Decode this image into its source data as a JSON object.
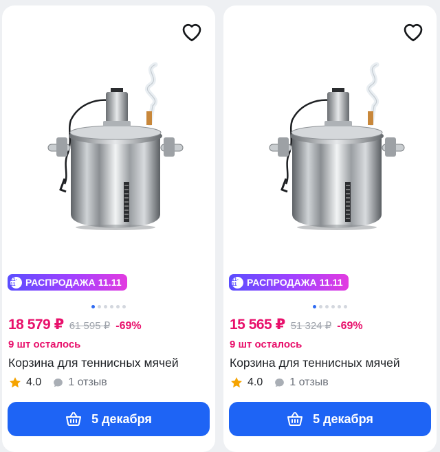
{
  "colors": {
    "accent_pink": "#e8106b",
    "button_blue": "#1e64f5",
    "promo_gradient": [
      "#5a4dff",
      "#a341ff",
      "#e23be0"
    ]
  },
  "products": [
    {
      "promo_label": "РАСПРОДАЖА 11.11",
      "promo_icon_text": "11-11",
      "price": "18 579 ₽",
      "old_price": "61 595 ₽",
      "discount": "-69%",
      "stock": "9 шт осталось",
      "title": "Корзина для теннисных мячей",
      "rating": "4.0",
      "reviews": "1 отзыв",
      "button_label": "5 декабря",
      "gallery_dots": 6,
      "gallery_active": 0
    },
    {
      "promo_label": "РАСПРОДАЖА 11.11",
      "promo_icon_text": "11-11",
      "price": "15 565 ₽",
      "old_price": "51 324 ₽",
      "discount": "-69%",
      "stock": "9 шт осталось",
      "title": "Корзина для теннисных мячей",
      "rating": "4.0",
      "reviews": "1 отзыв",
      "button_label": "5 декабря",
      "gallery_dots": 6,
      "gallery_active": 0
    }
  ]
}
